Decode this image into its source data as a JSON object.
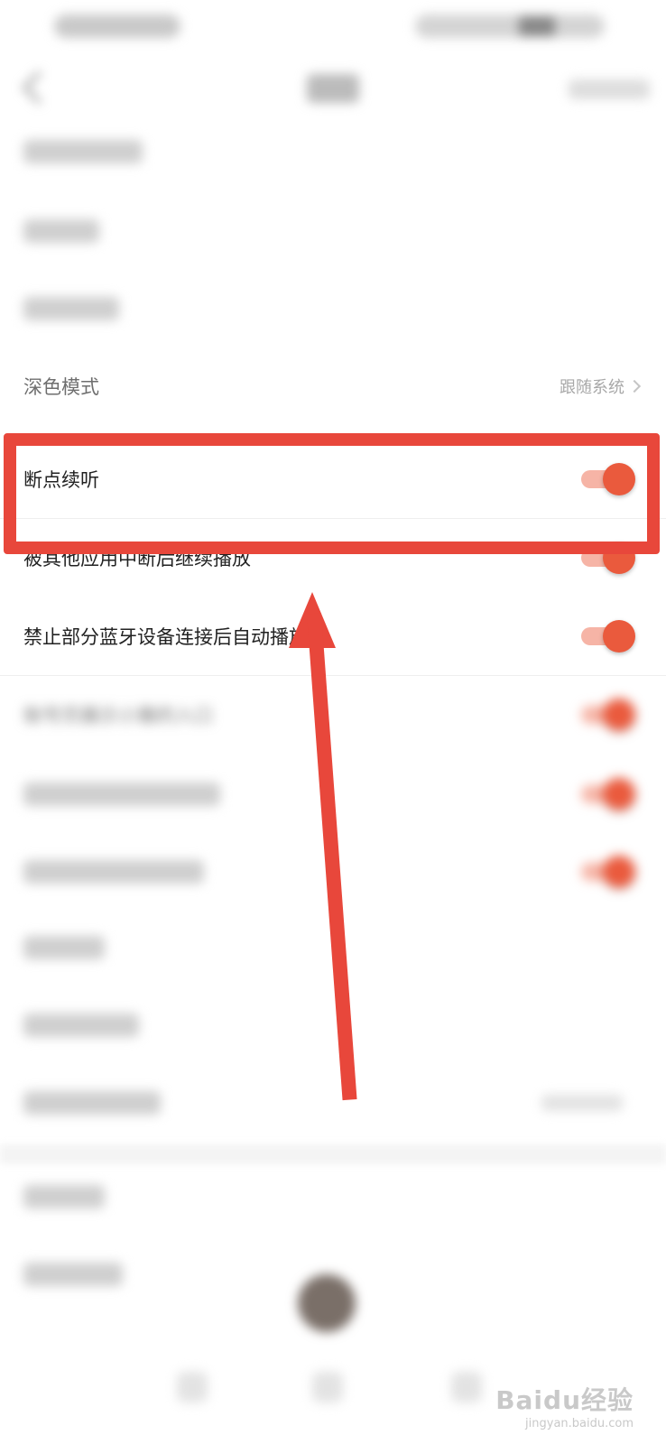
{
  "settings": {
    "dark_mode": {
      "label": "深色模式",
      "value": "跟随系统"
    },
    "resume_playback": {
      "label": "断点续听",
      "enabled": true
    },
    "interrupted_resume": {
      "label": "被其他应用中断后继续播放",
      "enabled": true
    },
    "bluetooth_block": {
      "label": "禁止部分蓝牙设备连接后自动播放",
      "enabled": true
    },
    "account_entry": {
      "label": "账号页展示小雅的入口",
      "enabled": true
    }
  },
  "colors": {
    "accent": "#ea5a3d",
    "accent_track": "#f6b4a6",
    "annotation": "#e8473b"
  },
  "watermark": {
    "text": "Baidu经验",
    "sub": "jingyan.baidu.com"
  }
}
